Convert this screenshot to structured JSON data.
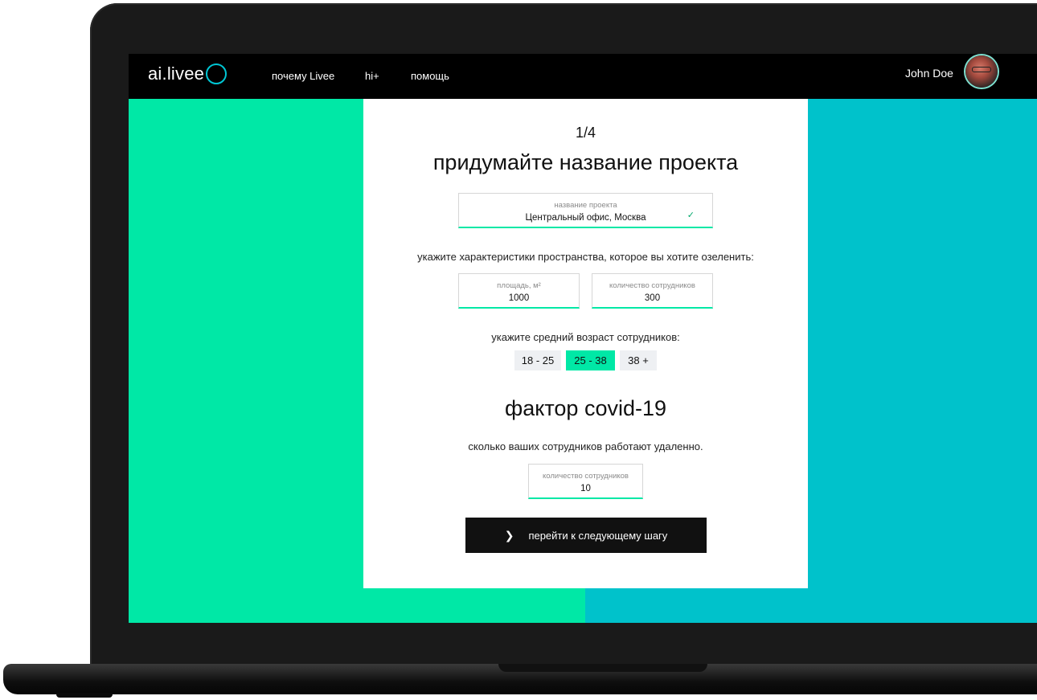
{
  "nav": {
    "logo": "ai.livee",
    "links": [
      "почему Livee",
      "hi+",
      "помощь"
    ],
    "user_name": "John Doe"
  },
  "form": {
    "step": "1/4",
    "title": "придумайте название проекта",
    "project_name": {
      "label": "название проекта",
      "value": "Центральный офис, Москва"
    },
    "space_prompt": "укажите характеристики пространства, которое вы хотите озеленить:",
    "area": {
      "label": "площадь, м²",
      "value": "1000"
    },
    "employees": {
      "label": "количество сотрудников",
      "value": "300"
    },
    "age_prompt": "укажите средний возраст сотрудников:",
    "age_options": [
      "18 - 25",
      "25 - 38",
      "38 +"
    ],
    "age_selected": "25 - 38",
    "covid_title": "фактор covid-19",
    "remote_prompt": "сколько ваших сотрудников работают удаленно.",
    "remote": {
      "label": "количество сотрудников",
      "value": "10"
    },
    "next_label": "перейти к следующему шагу"
  },
  "colors": {
    "mint": "#00e8a6",
    "teal": "#00c2cb",
    "nav_bg": "#000000"
  },
  "icons": [
    "logo-circle-icon",
    "check-icon",
    "chevron-right-icon"
  ]
}
